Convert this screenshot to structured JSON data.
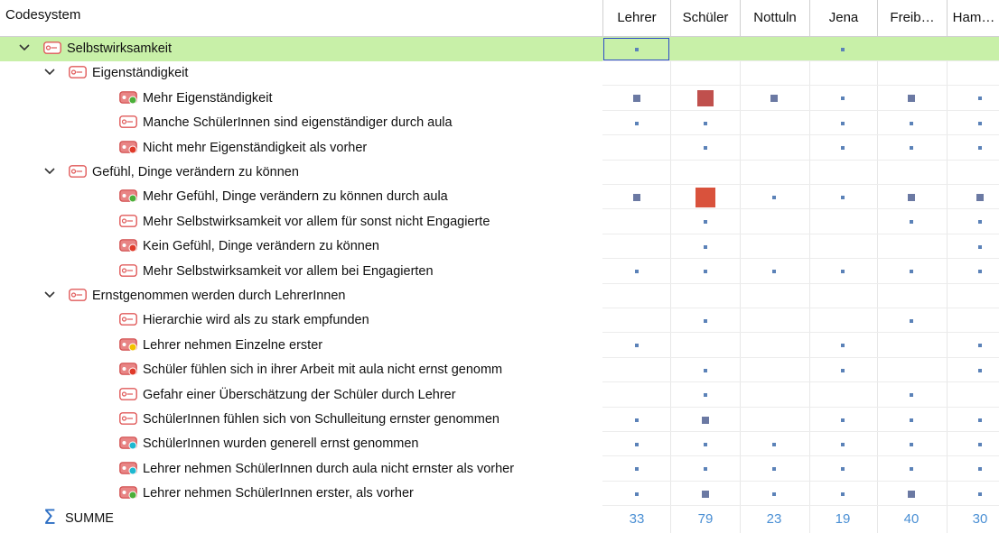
{
  "header": {
    "codesystem": "Codesystem",
    "columns": [
      "Lehrer",
      "Schüler",
      "Nottuln",
      "Jena",
      "Freib…",
      "Ham…"
    ]
  },
  "rows": [
    {
      "label": "Selbstwirksamkeit",
      "level": 0,
      "expand": true,
      "dot": "",
      "selected": true,
      "cells": [
        "s",
        "",
        "",
        "s",
        "",
        ""
      ]
    },
    {
      "label": "Eigenständigkeit",
      "level": 1,
      "expand": true,
      "dot": "",
      "cells": [
        "",
        "",
        "",
        "",
        "",
        ""
      ]
    },
    {
      "label": "Mehr Eigenständigkeit",
      "level": 2,
      "expand": false,
      "dot": "green",
      "cells": [
        "m",
        "L",
        "m",
        "s",
        "m",
        "s"
      ]
    },
    {
      "label": "Manche SchülerInnen sind eigenständiger durch aula",
      "level": 2,
      "expand": false,
      "dot": "",
      "cells": [
        "s",
        "s",
        "",
        "s",
        "s",
        "s"
      ]
    },
    {
      "label": "Nicht mehr Eigenständigkeit als vorher",
      "level": 2,
      "expand": false,
      "dot": "red",
      "cells": [
        "",
        "s",
        "",
        "s",
        "s",
        "s"
      ]
    },
    {
      "label": "Gefühl, Dinge verändern zu können",
      "level": 1,
      "expand": true,
      "dot": "",
      "cells": [
        "",
        "",
        "",
        "",
        "",
        ""
      ]
    },
    {
      "label": "Mehr Gefühl, Dinge verändern zu können durch aula",
      "level": 2,
      "expand": false,
      "dot": "green",
      "cells": [
        "m",
        "XL",
        "s",
        "s",
        "m",
        "m"
      ]
    },
    {
      "label": "Mehr Selbstwirksamkeit vor allem für sonst nicht Engagierte",
      "level": 2,
      "expand": false,
      "dot": "",
      "cells": [
        "",
        "s",
        "",
        "",
        "s",
        "s"
      ]
    },
    {
      "label": "Kein Gefühl, Dinge verändern zu können",
      "level": 2,
      "expand": false,
      "dot": "red",
      "cells": [
        "",
        "s",
        "",
        "",
        "",
        "s"
      ]
    },
    {
      "label": "Mehr Selbstwirksamkeit vor allem bei Engagierten",
      "level": 2,
      "expand": false,
      "dot": "",
      "cells": [
        "s",
        "s",
        "s",
        "s",
        "s",
        "s"
      ]
    },
    {
      "label": "Ernstgenommen werden durch LehrerInnen",
      "level": 1,
      "expand": true,
      "dot": "",
      "cells": [
        "",
        "",
        "",
        "",
        "",
        ""
      ]
    },
    {
      "label": "Hierarchie wird als zu stark empfunden",
      "level": 2,
      "expand": false,
      "dot": "",
      "cells": [
        "",
        "s",
        "",
        "",
        "s",
        ""
      ]
    },
    {
      "label": "Lehrer nehmen Einzelne erster",
      "level": 2,
      "expand": false,
      "dot": "yellow",
      "cells": [
        "s",
        "",
        "",
        "s",
        "",
        "s"
      ]
    },
    {
      "label": "Schüler fühlen sich in ihrer Arbeit mit aula nicht ernst genomm",
      "level": 2,
      "expand": false,
      "dot": "red",
      "cells": [
        "",
        "s",
        "",
        "s",
        "",
        "s"
      ]
    },
    {
      "label": "Gefahr einer Überschätzung der Schüler durch Lehrer",
      "level": 2,
      "expand": false,
      "dot": "",
      "cells": [
        "",
        "s",
        "",
        "",
        "s",
        ""
      ]
    },
    {
      "label": "SchülerInnen fühlen sich von Schulleitung ernster genommen",
      "level": 2,
      "expand": false,
      "dot": "",
      "cells": [
        "s",
        "m",
        "",
        "s",
        "s",
        "s"
      ]
    },
    {
      "label": "SchülerInnen wurden generell ernst genommen",
      "level": 2,
      "expand": false,
      "dot": "cyan",
      "cells": [
        "s",
        "s",
        "s",
        "s",
        "s",
        "s"
      ]
    },
    {
      "label": "Lehrer nehmen SchülerInnen durch aula nicht ernster als vorher",
      "level": 2,
      "expand": false,
      "dot": "cyan",
      "cells": [
        "s",
        "s",
        "s",
        "s",
        "s",
        "s"
      ]
    },
    {
      "label": "Lehrer nehmen SchülerInnen erster, als vorher",
      "level": 2,
      "expand": false,
      "dot": "green",
      "cells": [
        "s",
        "m",
        "s",
        "s",
        "m",
        "s"
      ]
    }
  ],
  "summary": {
    "label": "SUMME",
    "values": [
      "33",
      "79",
      "23",
      "19",
      "40",
      "30"
    ]
  },
  "colors": {
    "selected_row": "#c8f0a8",
    "sum_values": "#4a8fd4",
    "code_icon": "#e05a5a"
  }
}
